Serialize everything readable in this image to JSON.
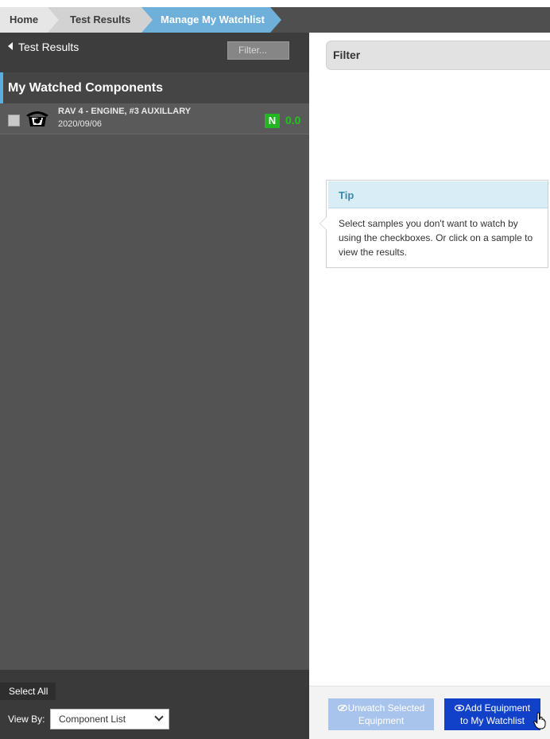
{
  "breadcrumb": {
    "home": "Home",
    "test_results": "Test Results",
    "active": "Manage My Watchlist"
  },
  "left": {
    "back_label": "Test Results",
    "filter_placeholder": "Filter...",
    "section_title": "My Watched Components",
    "items": [
      {
        "name": "RAV 4 - ENGINE, #3 AUXILLARY",
        "date": "2020/09/06",
        "status": "N",
        "score": "0.0",
        "icon": "engine-icon"
      }
    ],
    "select_all": "Select All",
    "view_by_label": "View By:",
    "view_by_value": "Component List"
  },
  "right": {
    "filter_title": "Filter",
    "tip_title": "Tip",
    "tip_text": "Select samples you don't want to watch by using the checkboxes. Or click on a sample to view the results.",
    "unwatch_line1": "Unwatch Selected",
    "unwatch_line2": "Equipment",
    "add_line1": "Add Equipment",
    "add_line2": "to My Watchlist"
  },
  "colors": {
    "accent_blue": "#6fb0db",
    "status_green": "#22b620",
    "primary_button": "#1141c9",
    "disabled_button": "#a9c4ec"
  }
}
